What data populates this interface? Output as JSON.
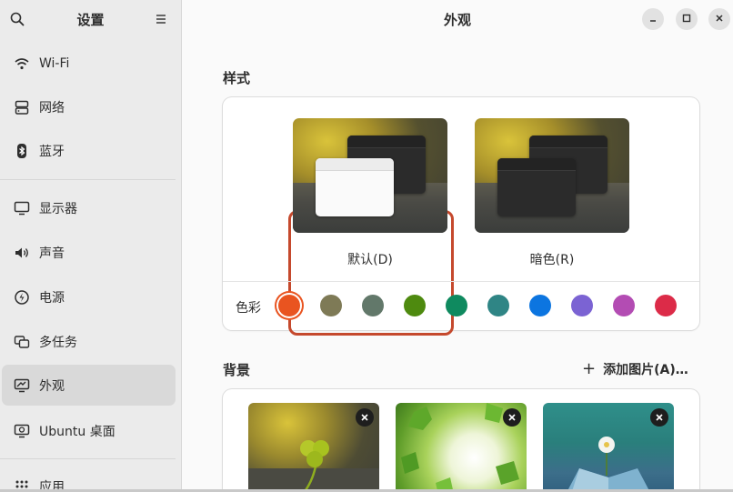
{
  "sidebar": {
    "title": "设置",
    "items": [
      {
        "label": "Wi-Fi",
        "icon": "wifi-icon"
      },
      {
        "label": "网络",
        "icon": "network-icon"
      },
      {
        "label": "蓝牙",
        "icon": "bluetooth-icon"
      },
      {
        "label": "显示器",
        "icon": "display-icon"
      },
      {
        "label": "声音",
        "icon": "sound-icon"
      },
      {
        "label": "电源",
        "icon": "power-icon"
      },
      {
        "label": "多任务",
        "icon": "multitasking-icon"
      },
      {
        "label": "外观",
        "icon": "appearance-icon"
      },
      {
        "label": "Ubuntu 桌面",
        "icon": "ubuntu-desktop-icon"
      },
      {
        "label": "应用",
        "icon": "apps-icon"
      }
    ],
    "active_item": "外观"
  },
  "header": {
    "title": "外观"
  },
  "style_section": {
    "title": "样式",
    "options": [
      {
        "label": "默认(D)",
        "selected": true
      },
      {
        "label": "暗色(R)",
        "selected": false
      }
    ],
    "color_label": "色彩",
    "colors": [
      "#e95420",
      "#7e7a56",
      "#62786a",
      "#4e8a0f",
      "#0f8a5f",
      "#2f8585",
      "#0c75e0",
      "#7b63d3",
      "#b34cb3",
      "#dc2b48"
    ],
    "selected_color": "#e95420"
  },
  "background_section": {
    "title": "背景",
    "add_label": "添加图片(A)…"
  }
}
